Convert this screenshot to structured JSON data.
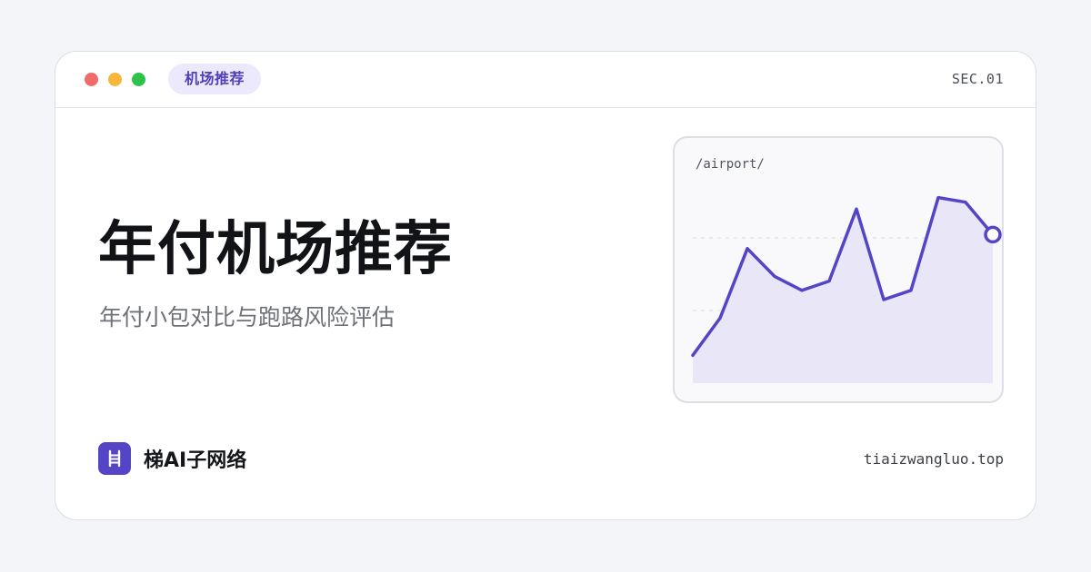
{
  "window": {
    "tag": "机场推荐",
    "section": "SEC.01",
    "controls": [
      "close",
      "minimize",
      "maximize"
    ]
  },
  "hero": {
    "title": "年付机场推荐",
    "subtitle": "年付小包对比与跑路风险评估"
  },
  "brand": {
    "name": "梯AI子网络",
    "logo_icon": "ladder-icon",
    "color": "#5444c6"
  },
  "footer": {
    "domain": "tiaizwangluo.top"
  },
  "colors": {
    "accent": "#5444c6",
    "tag_bg": "#ebe9fb",
    "close": "#f26b6b",
    "minimize": "#f8b739",
    "maximize": "#2ec24a"
  },
  "chart_data": {
    "type": "area",
    "title": "/airport/",
    "values": [
      12,
      28,
      58,
      46,
      40,
      44,
      75,
      36,
      40,
      80,
      78,
      64
    ],
    "ylim": [
      0,
      90
    ],
    "grid": true,
    "line_color": "#5444c6",
    "fill_color": "#e9e6f8"
  }
}
